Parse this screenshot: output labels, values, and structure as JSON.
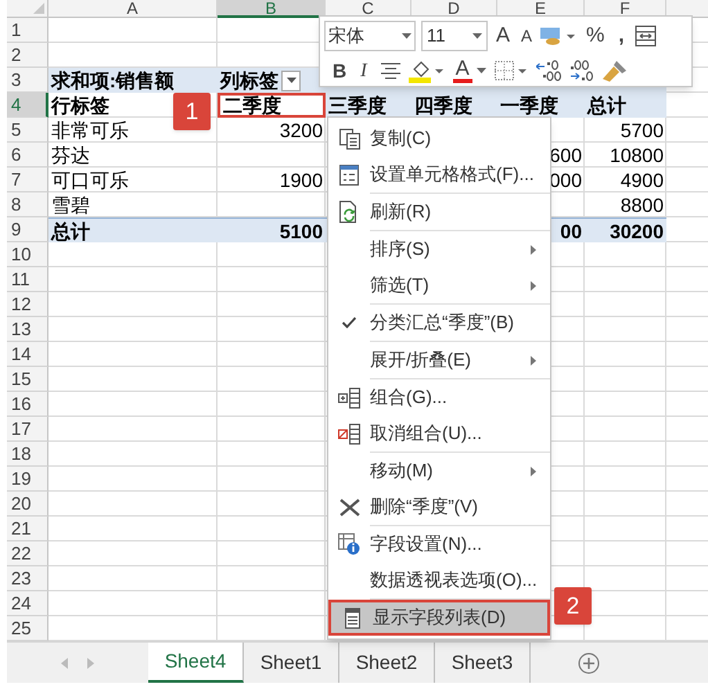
{
  "columns": [
    {
      "label": "A",
      "selected": false
    },
    {
      "label": "B",
      "selected": true
    },
    {
      "label": "C",
      "selected": false
    },
    {
      "label": "D",
      "selected": false
    },
    {
      "label": "E",
      "selected": false
    },
    {
      "label": "F",
      "selected": false
    }
  ],
  "rows": [
    {
      "number": "1",
      "selected": false,
      "kind": "blank"
    },
    {
      "number": "2",
      "selected": false,
      "kind": "blank"
    },
    {
      "number": "3",
      "selected": false,
      "kind": "pivot_header",
      "filter_dropdown": true,
      "cells": {
        "A": {
          "text": "求和项:销售额"
        },
        "B": {
          "text": "列标签"
        }
      }
    },
    {
      "number": "4",
      "selected": true,
      "kind": "field_header",
      "cells": {
        "A": {
          "text": "行标签"
        },
        "B": {
          "text": "二季度",
          "highlighted": true
        },
        "C": {
          "text": "三季度"
        },
        "D": {
          "text": "四季度"
        },
        "E": {
          "text": "一季度"
        },
        "F": {
          "text": "总计"
        }
      }
    },
    {
      "number": "5",
      "selected": false,
      "kind": "data",
      "cells": {
        "A": {
          "text": "非常可乐"
        },
        "B": {
          "text": "3200"
        },
        "F": {
          "text": "5700"
        }
      }
    },
    {
      "number": "6",
      "selected": false,
      "kind": "data",
      "cells": {
        "A": {
          "text": "芬达"
        },
        "E": {
          "text": "600"
        },
        "F": {
          "text": "10800"
        }
      }
    },
    {
      "number": "7",
      "selected": false,
      "kind": "data",
      "cells": {
        "A": {
          "text": "可口可乐"
        },
        "B": {
          "text": "1900"
        },
        "E": {
          "text": "000"
        },
        "F": {
          "text": "4900"
        }
      }
    },
    {
      "number": "8",
      "selected": false,
      "kind": "data",
      "cells": {
        "A": {
          "text": "雪碧"
        },
        "F": {
          "text": "8800"
        }
      }
    },
    {
      "number": "9",
      "selected": false,
      "kind": "total",
      "cells": {
        "A": {
          "text": "总计"
        },
        "B": {
          "text": "5100"
        },
        "E": {
          "text": "00"
        },
        "F": {
          "text": "30200"
        }
      }
    },
    {
      "number": "10",
      "selected": false,
      "kind": "blank"
    },
    {
      "number": "11",
      "selected": false,
      "kind": "blank"
    },
    {
      "number": "12",
      "selected": false,
      "kind": "blank"
    },
    {
      "number": "13",
      "selected": false,
      "kind": "blank"
    },
    {
      "number": "14",
      "selected": false,
      "kind": "blank"
    },
    {
      "number": "15",
      "selected": false,
      "kind": "blank"
    },
    {
      "number": "16",
      "selected": false,
      "kind": "blank"
    },
    {
      "number": "17",
      "selected": false,
      "kind": "blank"
    },
    {
      "number": "18",
      "selected": false,
      "kind": "blank"
    },
    {
      "number": "19",
      "selected": false,
      "kind": "blank"
    },
    {
      "number": "20",
      "selected": false,
      "kind": "blank"
    },
    {
      "number": "21",
      "selected": false,
      "kind": "blank"
    },
    {
      "number": "22",
      "selected": false,
      "kind": "blank"
    },
    {
      "number": "23",
      "selected": false,
      "kind": "blank"
    },
    {
      "number": "24",
      "selected": false,
      "kind": "blank"
    },
    {
      "number": "25",
      "selected": false,
      "kind": "blank"
    }
  ],
  "mini_toolbar": {
    "font": "宋体",
    "size": "11",
    "grow_font_label": "A",
    "shrink_font_label": "A",
    "percent_label": "%",
    "comma_label": ",",
    "bold_label": "B",
    "italic_label": "I",
    "font_color_label": "A"
  },
  "context_menu": [
    {
      "label": "复制(C)",
      "kind": "copy",
      "submenu": false,
      "checked": false,
      "selected": false,
      "separator_after": false
    },
    {
      "label": "设置单元格格式(F)...",
      "kind": "format_cells",
      "submenu": false,
      "checked": false,
      "selected": false,
      "separator_after": true
    },
    {
      "label": "刷新(R)",
      "kind": "refresh",
      "submenu": false,
      "checked": false,
      "selected": false,
      "separator_after": true
    },
    {
      "label": "排序(S)",
      "kind": "plain",
      "submenu": true,
      "checked": false,
      "selected": false,
      "separator_after": false
    },
    {
      "label": "筛选(T)",
      "kind": "plain",
      "submenu": true,
      "checked": false,
      "selected": false,
      "separator_after": true
    },
    {
      "label": "分类汇总“季度”(B)",
      "kind": "plain",
      "submenu": false,
      "checked": true,
      "selected": false,
      "separator_after": true
    },
    {
      "label": "展开/折叠(E)",
      "kind": "plain",
      "submenu": true,
      "checked": false,
      "selected": false,
      "separator_after": true
    },
    {
      "label": "组合(G)...",
      "kind": "group",
      "submenu": false,
      "checked": false,
      "selected": false,
      "separator_after": false
    },
    {
      "label": "取消组合(U)...",
      "kind": "ungroup",
      "submenu": false,
      "checked": false,
      "selected": false,
      "separator_after": true
    },
    {
      "label": "移动(M)",
      "kind": "plain",
      "submenu": true,
      "checked": false,
      "selected": false,
      "separator_after": false
    },
    {
      "label": "删除“季度”(V)",
      "kind": "delete",
      "submenu": false,
      "checked": false,
      "selected": false,
      "separator_after": true
    },
    {
      "label": "字段设置(N)...",
      "kind": "field_settings",
      "submenu": false,
      "checked": false,
      "selected": false,
      "separator_after": false
    },
    {
      "label": "数据透视表选项(O)...",
      "kind": "plain",
      "submenu": false,
      "checked": false,
      "selected": false,
      "separator_after": true
    },
    {
      "label": "显示字段列表(D)",
      "kind": "field_list",
      "submenu": false,
      "checked": false,
      "selected": true,
      "separator_after": false
    }
  ],
  "callouts": [
    {
      "label": "1"
    },
    {
      "label": "2"
    }
  ],
  "sheet_tabs": [
    {
      "label": "Sheet4",
      "selected": true
    },
    {
      "label": "Sheet1",
      "selected": false
    },
    {
      "label": "Sheet2",
      "selected": false
    },
    {
      "label": "Sheet3",
      "selected": false
    }
  ]
}
